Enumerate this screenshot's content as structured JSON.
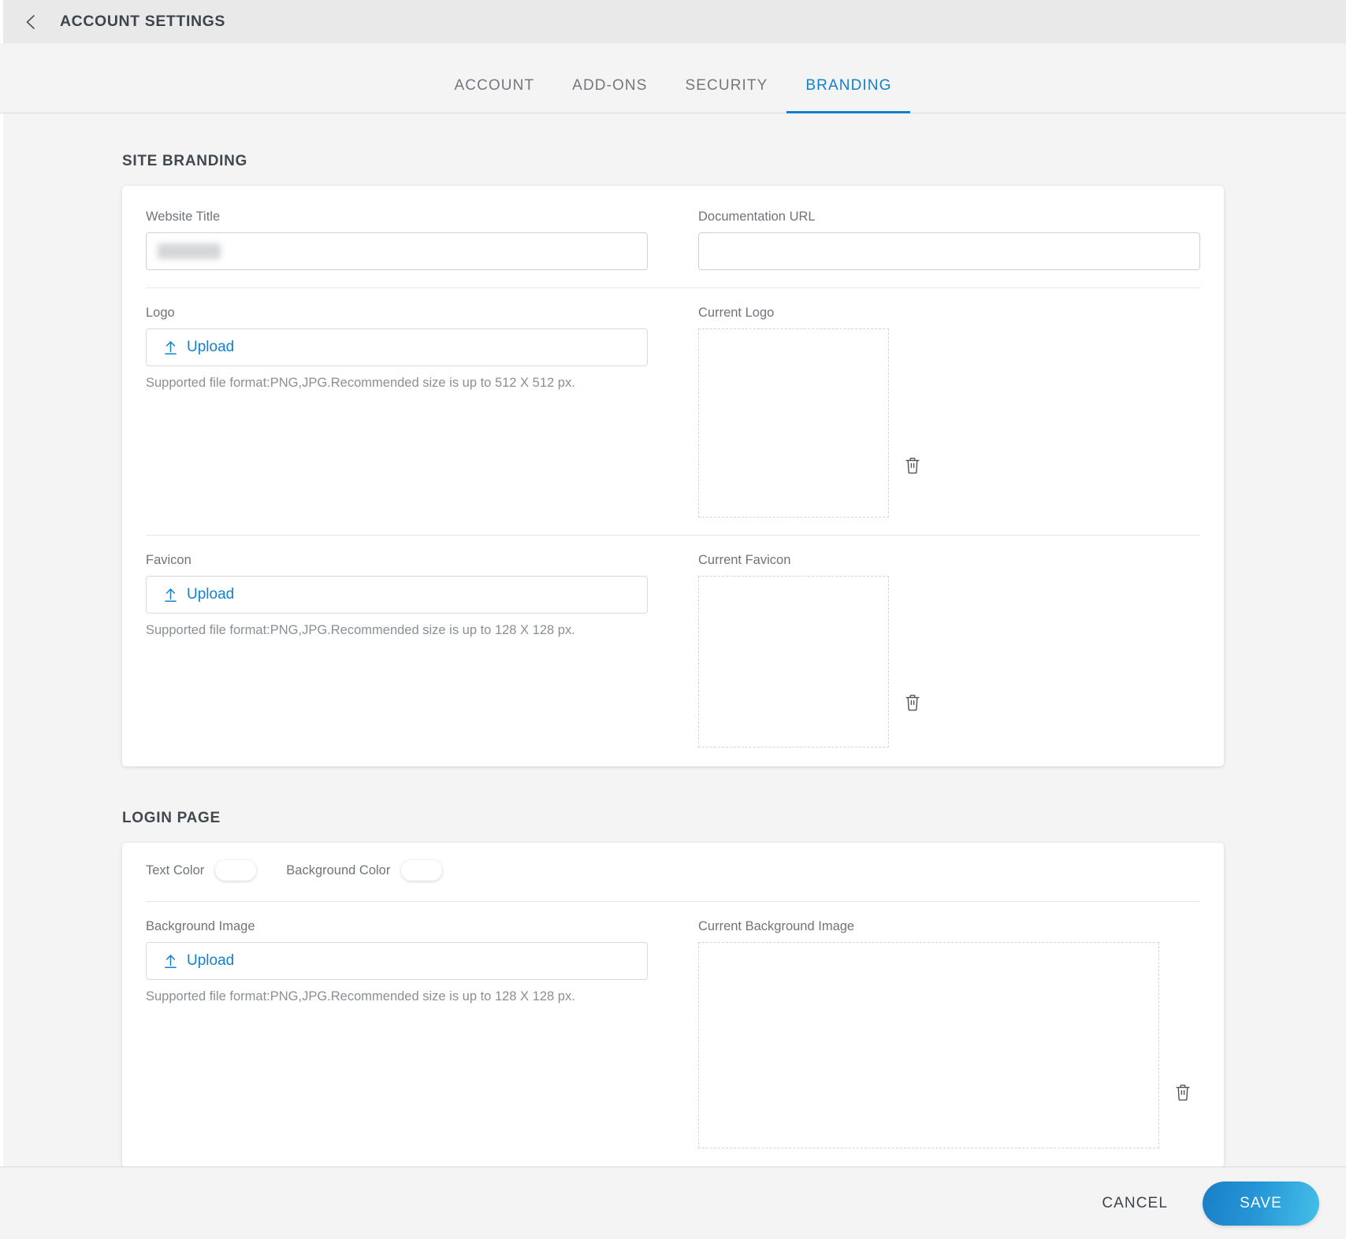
{
  "header": {
    "back_icon": "chevron-left-icon",
    "title": "ACCOUNT SETTINGS"
  },
  "tabs": [
    {
      "label": "ACCOUNT",
      "active": false
    },
    {
      "label": "ADD-ONS",
      "active": false
    },
    {
      "label": "SECURITY",
      "active": false
    },
    {
      "label": "BRANDING",
      "active": true
    }
  ],
  "site_branding": {
    "section_title": "SITE BRANDING",
    "website_title": {
      "label": "Website Title",
      "value": "",
      "value_redacted": true,
      "placeholder": ""
    },
    "documentation_url": {
      "label": "Documentation URL",
      "value": "",
      "placeholder": ""
    },
    "logo": {
      "label": "Logo",
      "upload_label": "Upload",
      "upload_icon": "upload-arrow-icon",
      "hint": "Supported file format:PNG,JPG.Recommended size is up to 512 X 512 px.",
      "current_label": "Current Logo",
      "current_empty": true,
      "delete_icon": "trash-icon"
    },
    "favicon": {
      "label": "Favicon",
      "upload_label": "Upload",
      "upload_icon": "upload-arrow-icon",
      "hint": "Supported file format:PNG,JPG.Recommended size is up to 128 X 128 px.",
      "current_label": "Current Favicon",
      "current_empty": true,
      "delete_icon": "trash-icon"
    }
  },
  "login_page": {
    "section_title": "LOGIN PAGE",
    "text_color": {
      "label": "Text Color",
      "value": "#ffffff"
    },
    "background_color": {
      "label": "Background Color",
      "value": "#ffffff"
    },
    "background_image": {
      "label": "Background Image",
      "upload_label": "Upload",
      "upload_icon": "upload-arrow-icon",
      "hint": "Supported file format:PNG,JPG.Recommended size is up to 128 X 128 px.",
      "current_label": "Current Background Image",
      "current_empty": true,
      "delete_icon": "trash-icon"
    }
  },
  "footer": {
    "cancel_label": "CANCEL",
    "save_label": "SAVE"
  },
  "colors": {
    "accent": "#1380ce",
    "save_gradient_start": "#1b7fc4",
    "save_gradient_end": "#45bfe8",
    "page_bg": "#f4f4f4",
    "topbar_bg": "#e9e9e9",
    "card_bg": "#ffffff",
    "label_text": "#6f747a",
    "hint_text": "#8a8f94",
    "title_text": "#3f444b"
  }
}
